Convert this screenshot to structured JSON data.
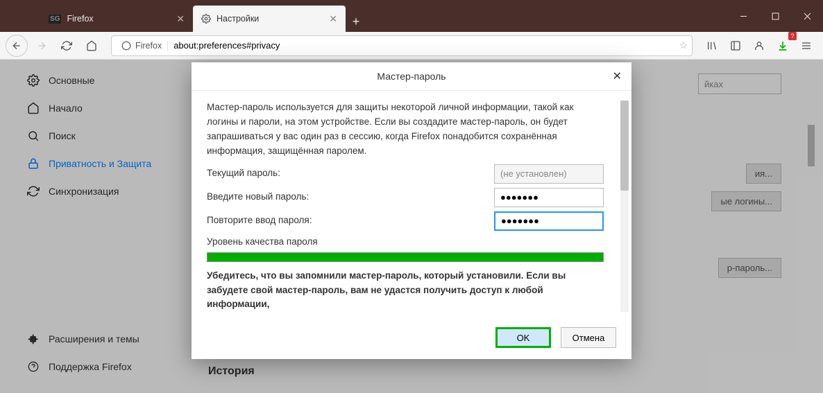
{
  "window": {
    "tabs": [
      {
        "title": "Firefox",
        "active": false
      },
      {
        "title": "Настройки",
        "active": true
      }
    ]
  },
  "urlbar": {
    "identity": "Firefox",
    "url": "about:preferences#privacy"
  },
  "sidebar": {
    "items": [
      {
        "label": "Основные",
        "icon": "gear"
      },
      {
        "label": "Начало",
        "icon": "home"
      },
      {
        "label": "Поиск",
        "icon": "search"
      },
      {
        "label": "Приватность и Защита",
        "icon": "lock",
        "active": true
      },
      {
        "label": "Синхронизация",
        "icon": "sync"
      }
    ],
    "footer": [
      {
        "label": "Расширения и темы",
        "icon": "puzzle"
      },
      {
        "label": "Поддержка Firefox",
        "icon": "help"
      }
    ]
  },
  "background": {
    "search_suffix": "йках",
    "btn1": "ия...",
    "btn2": "ые логины...",
    "btn3": "р-пароль...",
    "history_heading": "История"
  },
  "dialog": {
    "title": "Мастер-пароль",
    "description": "Мастер-пароль используется для защиты некоторой личной информации, такой как логины и пароли, на этом устройстве. Если вы создадите мастер-пароль, он будет запрашиваться у вас один раз в сессию, когда Firefox понадобится сохранённая информация, защищённая паролем.",
    "current_label": "Текущий пароль:",
    "current_value": "(не установлен)",
    "new_label": "Введите новый пароль:",
    "new_value": "●●●●●●●",
    "repeat_label": "Повторите ввод пароля:",
    "repeat_value": "●●●●●●●",
    "quality_label": "Уровень качества пароля",
    "warning": "Убедитесь, что вы запомнили мастер-пароль, который установили. Если вы забудете свой мастер-пароль, вам не удастся получить доступ к любой информации,",
    "ok": "OK",
    "cancel": "Отмена"
  }
}
